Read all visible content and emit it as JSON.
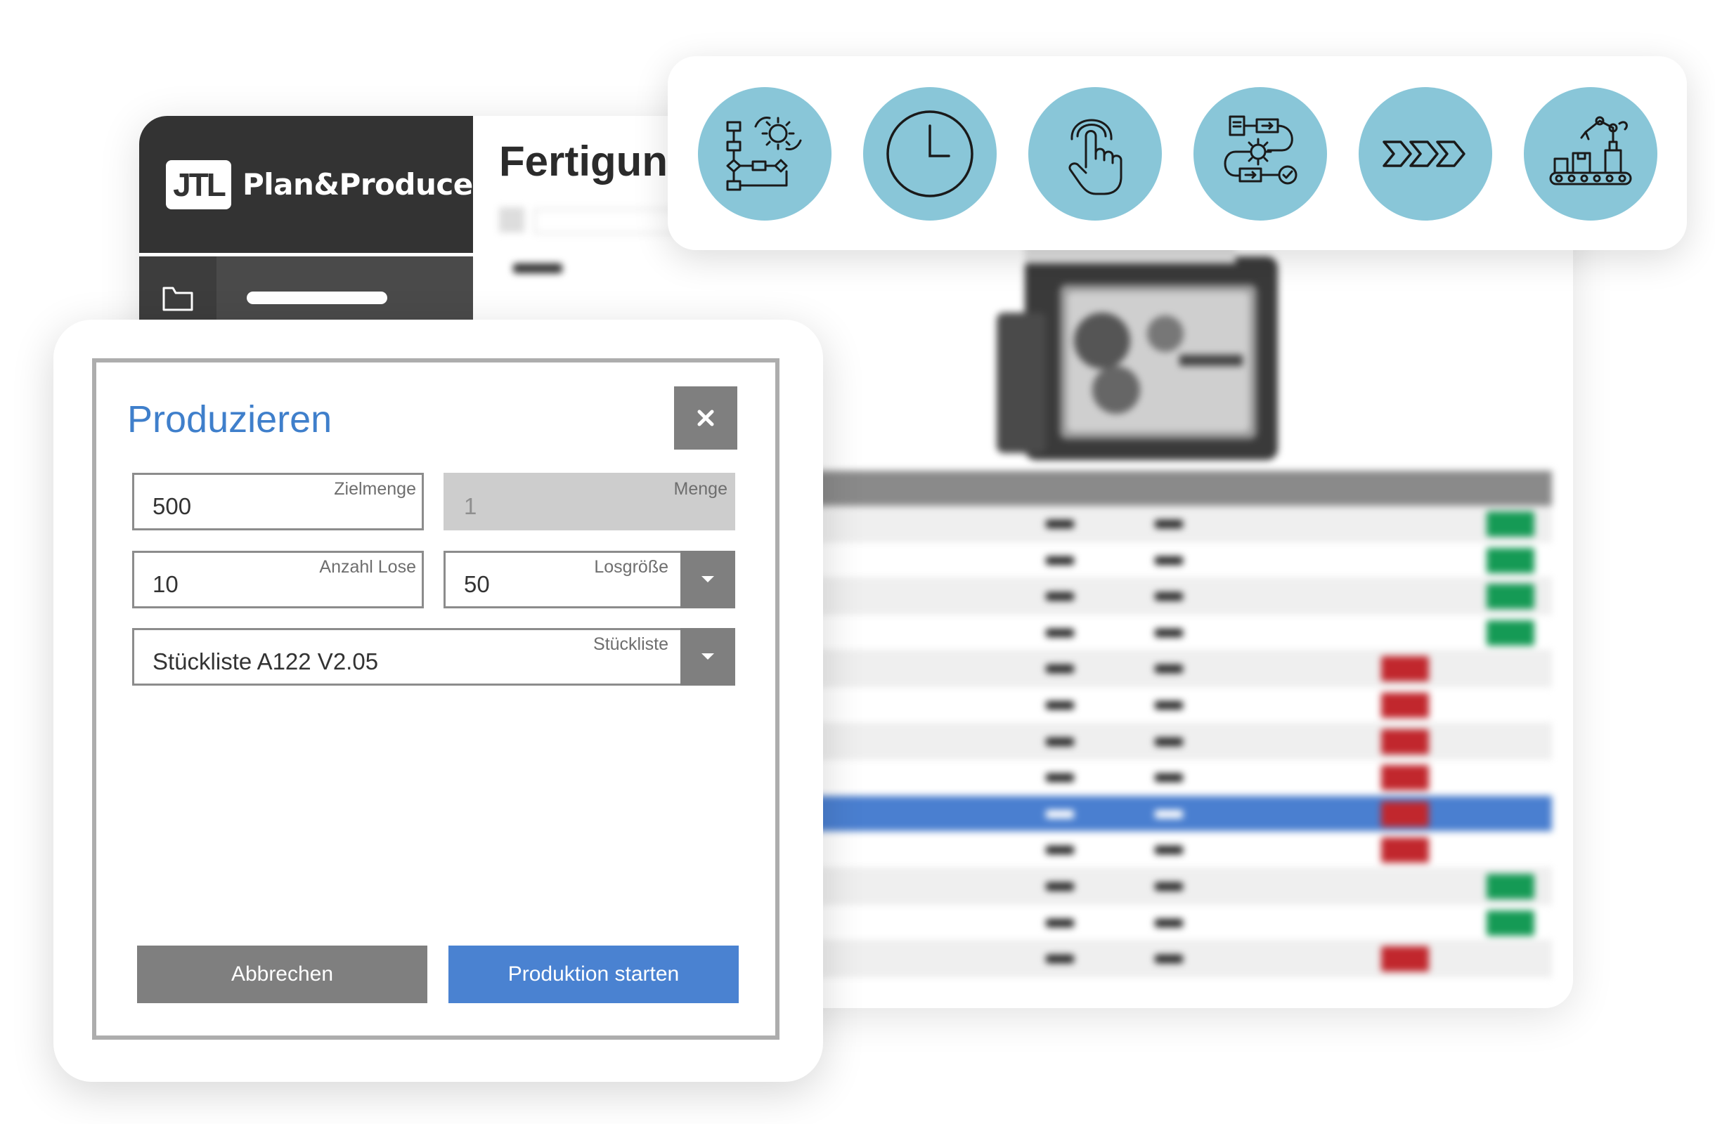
{
  "app": {
    "logo_mark": "JTL",
    "logo_text": "Plan&Produce",
    "page_title": "Fertigung"
  },
  "icon_strip": {
    "icons": [
      "process-flow-gear-icon",
      "clock-icon",
      "touch-hand-icon",
      "workflow-gear-icon",
      "chevrons-right-icon",
      "robot-conveyor-icon"
    ],
    "circle_color": "#89c6d8"
  },
  "dialog": {
    "title": "Produzieren",
    "close_symbol": "×",
    "fields": {
      "zielmenge": {
        "label": "Zielmenge",
        "value": "500"
      },
      "menge": {
        "label": "Menge",
        "value": "1"
      },
      "anzahl_lose": {
        "label": "Anzahl Lose",
        "value": "10"
      },
      "losgroesse": {
        "label": "Losgröße",
        "value": "50"
      },
      "stueckliste": {
        "label": "Stückliste",
        "value": "Stückliste A122 V2.05"
      }
    },
    "cancel_label": "Abbrechen",
    "start_label": "Produktion starten"
  },
  "table": {
    "row_actions": [
      "plus",
      "plus",
      "plus",
      "plus",
      "minus",
      "minus",
      "minus",
      "minus",
      "minus",
      "minus",
      "plus",
      "plus",
      "minus"
    ],
    "selected_row": 8
  },
  "colors": {
    "accent_blue": "#4a82d1",
    "title_blue": "#3f7fcb",
    "dark_header": "#333333",
    "plus_green": "#159a55",
    "minus_red": "#c1272d"
  }
}
